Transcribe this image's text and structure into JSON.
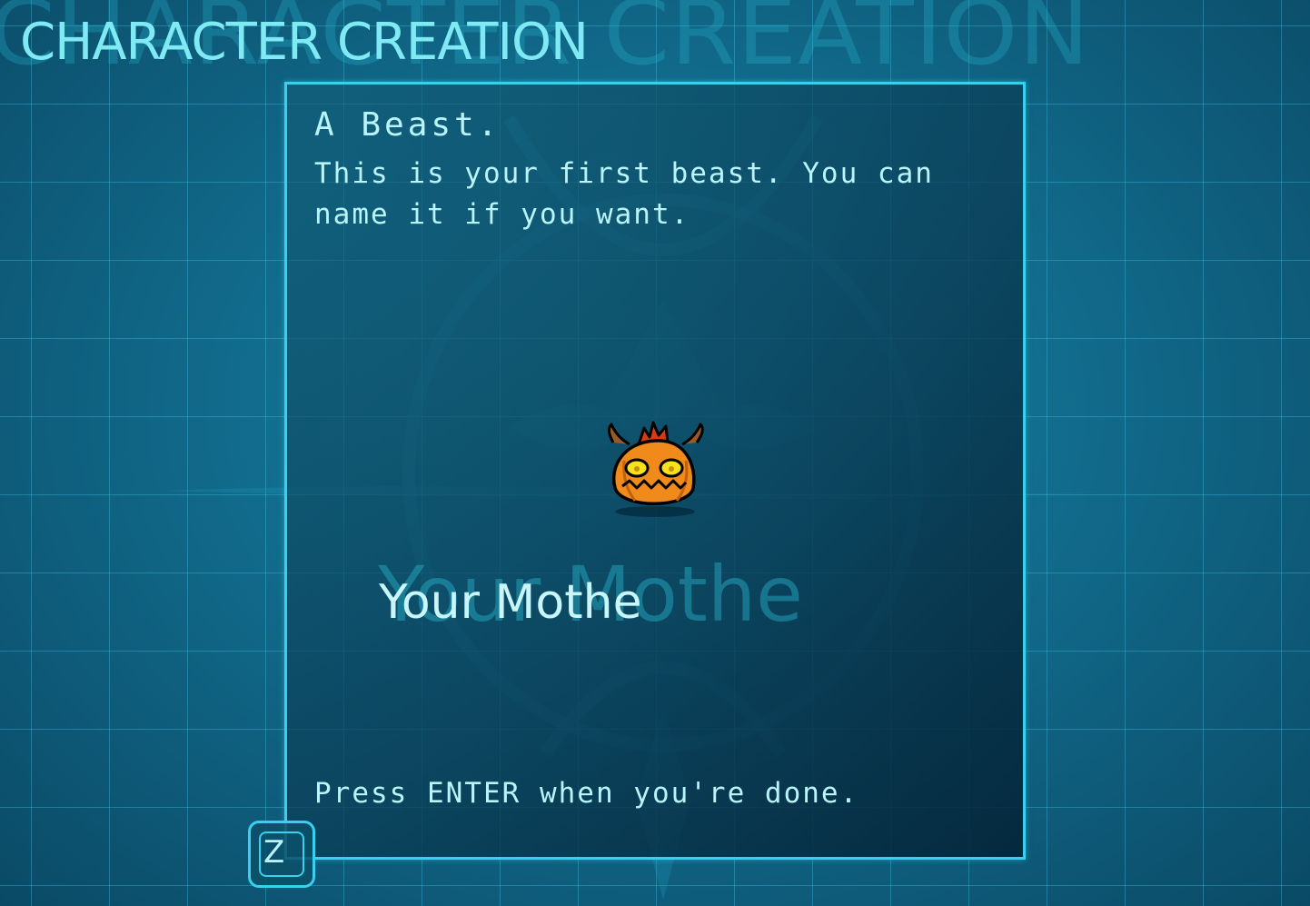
{
  "screen": {
    "title": "CHARACTER CREATION"
  },
  "panel": {
    "heading": "A Beast.",
    "description": "This is your first beast. You can name it if you want.",
    "creature_icon": "horned-pumpkin-beast-icon",
    "name_value": "Your Mothe",
    "name_ghost": "Your Mothe",
    "footer": "Press ENTER when you're done."
  },
  "controls": {
    "z_key_label": "Z"
  },
  "colors": {
    "accent": "#38d0ee",
    "text": "#b9f4fa",
    "title": "#7fe9f4",
    "creature_orange": "#f08a1a"
  }
}
